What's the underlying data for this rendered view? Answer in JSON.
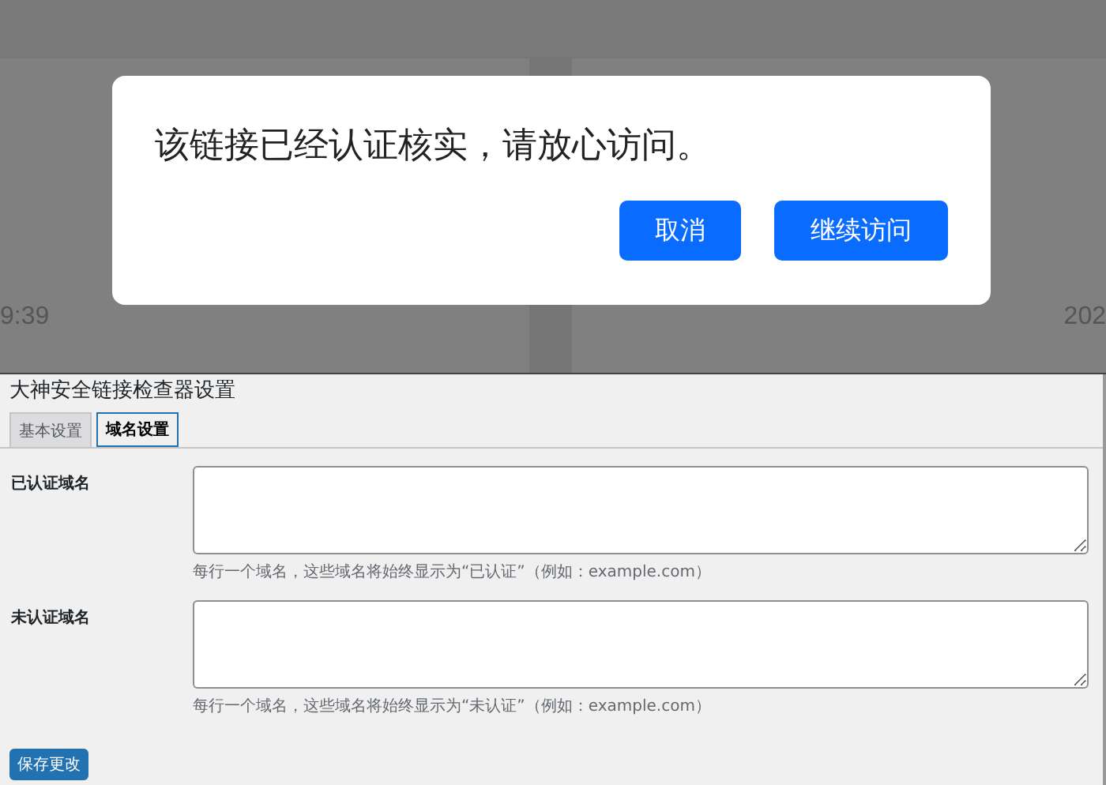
{
  "backdrop": {
    "left_text": "9:39",
    "right_text": "202"
  },
  "dialog": {
    "message": "该链接已经认证核实，请放心访问。",
    "buttons": [
      {
        "label": "取消"
      },
      {
        "label": "继续访问"
      }
    ]
  },
  "page": {
    "title": "大神安全链接检查器设置",
    "tabs": [
      {
        "label": "基本设置",
        "selected": false
      },
      {
        "label": "域名设置",
        "selected": true
      }
    ],
    "fields": [
      {
        "label": "已认证域名",
        "help": "每行一个域名，这些域名将始终显示为“已认证”（例如：example.com）"
      },
      {
        "label": "未认证域名",
        "help": "每行一个域名，这些域名将始终显示为“未认证”（例如：example.com）"
      }
    ],
    "save_button": "保存更改"
  }
}
